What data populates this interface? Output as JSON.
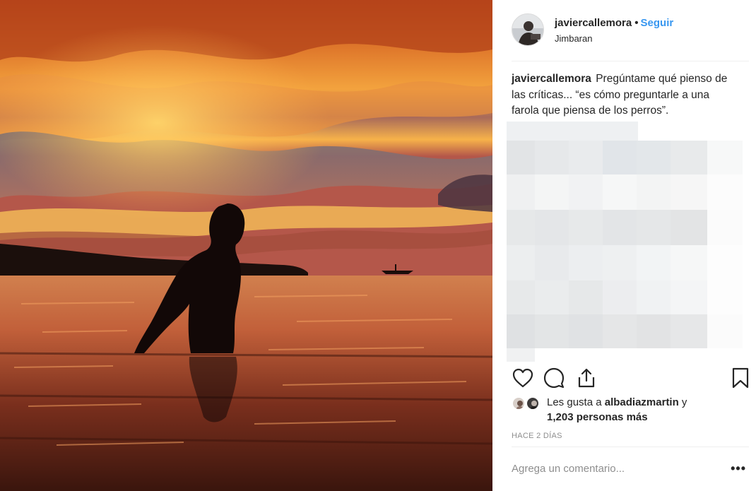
{
  "post": {
    "author": "javiercallemora",
    "separator": "•",
    "follow_label": "Seguir",
    "location": "Jimbaran",
    "caption_user": "javiercallemora",
    "caption_text": "Pregúntame qué pienso de las críticas... “es cómo preguntarle a una farola que piensa de los perros”.",
    "likes_line1_prefix": "Les gusta a ",
    "likes_line1_user": "albadiazmartin",
    "likes_line1_suffix": " y",
    "likes_line2_count": "1,203 personas más",
    "timestamp": "HACE 2 DÍAS",
    "comment_placeholder": "Agrega un comentario...",
    "more_label": "•••"
  },
  "icons": {
    "like": "heart-icon",
    "comment": "comment-icon",
    "share": "share-icon",
    "save": "bookmark-icon",
    "more": "more-options-icon"
  },
  "colors": {
    "link_blue": "#3897f0",
    "text": "#262626",
    "muted": "#8e8e8e",
    "divider": "#efefef"
  }
}
